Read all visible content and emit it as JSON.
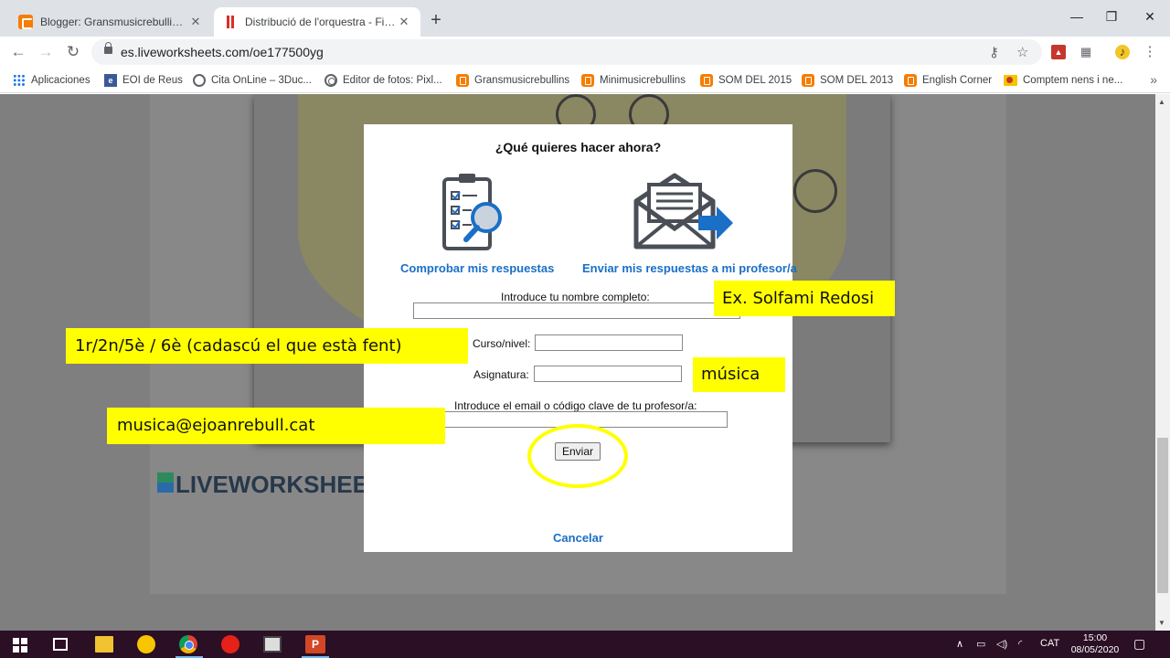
{
  "browser": {
    "tabs": [
      {
        "title": "Blogger: Gransmusicrebullins - C",
        "icon": "blogger-icon",
        "active": false
      },
      {
        "title": "Distribució de l'orquestra - Ficha",
        "icon": "liveworksheets-icon",
        "active": true
      }
    ],
    "new_tab": "+",
    "window_controls": {
      "minimize": "—",
      "restore": "❐",
      "close": "✕"
    },
    "url": "es.liveworksheets.com/oe177500yg"
  },
  "bookmarks": [
    {
      "label": "Aplicaciones",
      "icon": "apps-icon"
    },
    {
      "label": "EOI de Reus",
      "icon": "eoi-icon"
    },
    {
      "label": "Cita OnLine – 3Duc...",
      "icon": "globe-icon"
    },
    {
      "label": "Editor de fotos: Pixl...",
      "icon": "camera-icon"
    },
    {
      "label": "Gransmusicrebullins",
      "icon": "blogger-icon"
    },
    {
      "label": "Minimusicrebullins",
      "icon": "blogger-icon"
    },
    {
      "label": "SOM DEL 2015",
      "icon": "blogger-icon"
    },
    {
      "label": "SOM DEL 2013",
      "icon": "blogger-icon"
    },
    {
      "label": "English Corner",
      "icon": "blogger-icon"
    },
    {
      "label": "Comptem nens i ne...",
      "icon": "folder-icon"
    }
  ],
  "page": {
    "logo_text": "LIVEWORKSHEETS"
  },
  "modal": {
    "title": "¿Qué quieres hacer ahora?",
    "check_label": "Comprobar mis respuestas",
    "send_teacher_label": "Enviar mis respuestas a mi profesor/a",
    "name_label": "Introduce tu nombre completo:",
    "course_label": "Curso/nivel:",
    "subject_label": "Asignatura:",
    "email_label": "Introduce el email o código clave de tu profesor/a:",
    "send_button": "Enviar",
    "cancel": "Cancelar",
    "name_value": "",
    "course_value": "",
    "subject_value": "",
    "email_value": ""
  },
  "annotations": {
    "name_example": "Ex. Solfami Redosi",
    "course_example": "1r/2n/5è / 6è (cadascú el que està fent)",
    "subject_example": "música",
    "email_example": "musica@ejoanrebull.cat"
  },
  "taskbar": {
    "ppt_letter": "P",
    "lang": "CAT",
    "time": "15:00",
    "date": "08/05/2020"
  },
  "colors": {
    "link_blue": "#1a6fc7",
    "highlight_yellow": "#ffff00",
    "taskbar": "#2a0f25"
  }
}
